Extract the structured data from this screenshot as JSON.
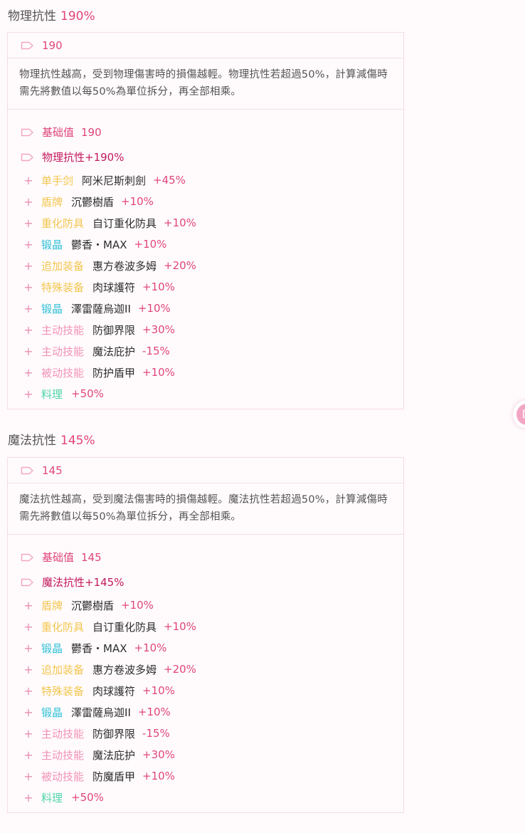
{
  "colors": {
    "accent": "#e0457b",
    "equipment": "#f3c64f",
    "crystal": "#2fc0d4",
    "skill": "#f292b6",
    "food": "#4fd4a8"
  },
  "sections": [
    {
      "title": "物理抗性",
      "percent": "190%",
      "head_value": "190",
      "description": "物理抗性越高，受到物理傷害時的損傷越輕。物理抗性若超過50%，計算減傷時需先將數值以每50%為單位拆分，再全部相乘。",
      "base_label": "基础值",
      "base_value": "190",
      "total_label": "物理抗性+190%",
      "items": [
        {
          "cat": "单手剑",
          "color": "yellow",
          "name": "阿米尼斯刺劍",
          "value": "+45%"
        },
        {
          "cat": "盾牌",
          "color": "yellow",
          "name": "沉鬱樹盾",
          "value": "+10%"
        },
        {
          "cat": "重化防具",
          "color": "yellow",
          "name": "自订重化防具",
          "value": "+10%"
        },
        {
          "cat": "锻晶",
          "color": "cyan",
          "name": "鬱香・MAX",
          "value": "+10%"
        },
        {
          "cat": "追加装备",
          "color": "yellow",
          "name": "惠方卷波多姆",
          "value": "+20%"
        },
        {
          "cat": "特殊装备",
          "color": "yellow",
          "name": "肉球護符",
          "value": "+10%"
        },
        {
          "cat": "锻晶",
          "color": "cyan",
          "name": "澤雷薩烏迦II",
          "value": "+10%"
        },
        {
          "cat": "主动技能",
          "color": "pink",
          "name": "防御界限",
          "value": "+30%"
        },
        {
          "cat": "主动技能",
          "color": "pink",
          "name": "魔法庇护",
          "value": "-15%"
        },
        {
          "cat": "被动技能",
          "color": "pink",
          "name": "防护盾甲",
          "value": "+10%"
        },
        {
          "cat": "料理",
          "color": "green",
          "name": "",
          "value": "+50%"
        }
      ]
    },
    {
      "title": "魔法抗性",
      "percent": "145%",
      "head_value": "145",
      "description": "魔法抗性越高，受到魔法傷害時的損傷越輕。魔法抗性若超過50%，計算減傷時需先將數值以每50%為單位拆分，再全部相乘。",
      "base_label": "基础值",
      "base_value": "145",
      "total_label": "魔法抗性+145%",
      "items": [
        {
          "cat": "盾牌",
          "color": "yellow",
          "name": "沉鬱樹盾",
          "value": "+10%"
        },
        {
          "cat": "重化防具",
          "color": "yellow",
          "name": "自订重化防具",
          "value": "+10%"
        },
        {
          "cat": "锻晶",
          "color": "cyan",
          "name": "鬱香・MAX",
          "value": "+10%"
        },
        {
          "cat": "追加装备",
          "color": "yellow",
          "name": "惠方卷波多姆",
          "value": "+20%"
        },
        {
          "cat": "特殊装备",
          "color": "yellow",
          "name": "肉球護符",
          "value": "+10%"
        },
        {
          "cat": "锻晶",
          "color": "cyan",
          "name": "澤雷薩烏迦II",
          "value": "+10%"
        },
        {
          "cat": "主动技能",
          "color": "pink",
          "name": "防御界限",
          "value": "-15%"
        },
        {
          "cat": "主动技能",
          "color": "pink",
          "name": "魔法庇护",
          "value": "+30%"
        },
        {
          "cat": "被动技能",
          "color": "pink",
          "name": "防魔盾甲",
          "value": "+10%"
        },
        {
          "cat": "料理",
          "color": "green",
          "name": "",
          "value": "+50%"
        }
      ]
    }
  ]
}
